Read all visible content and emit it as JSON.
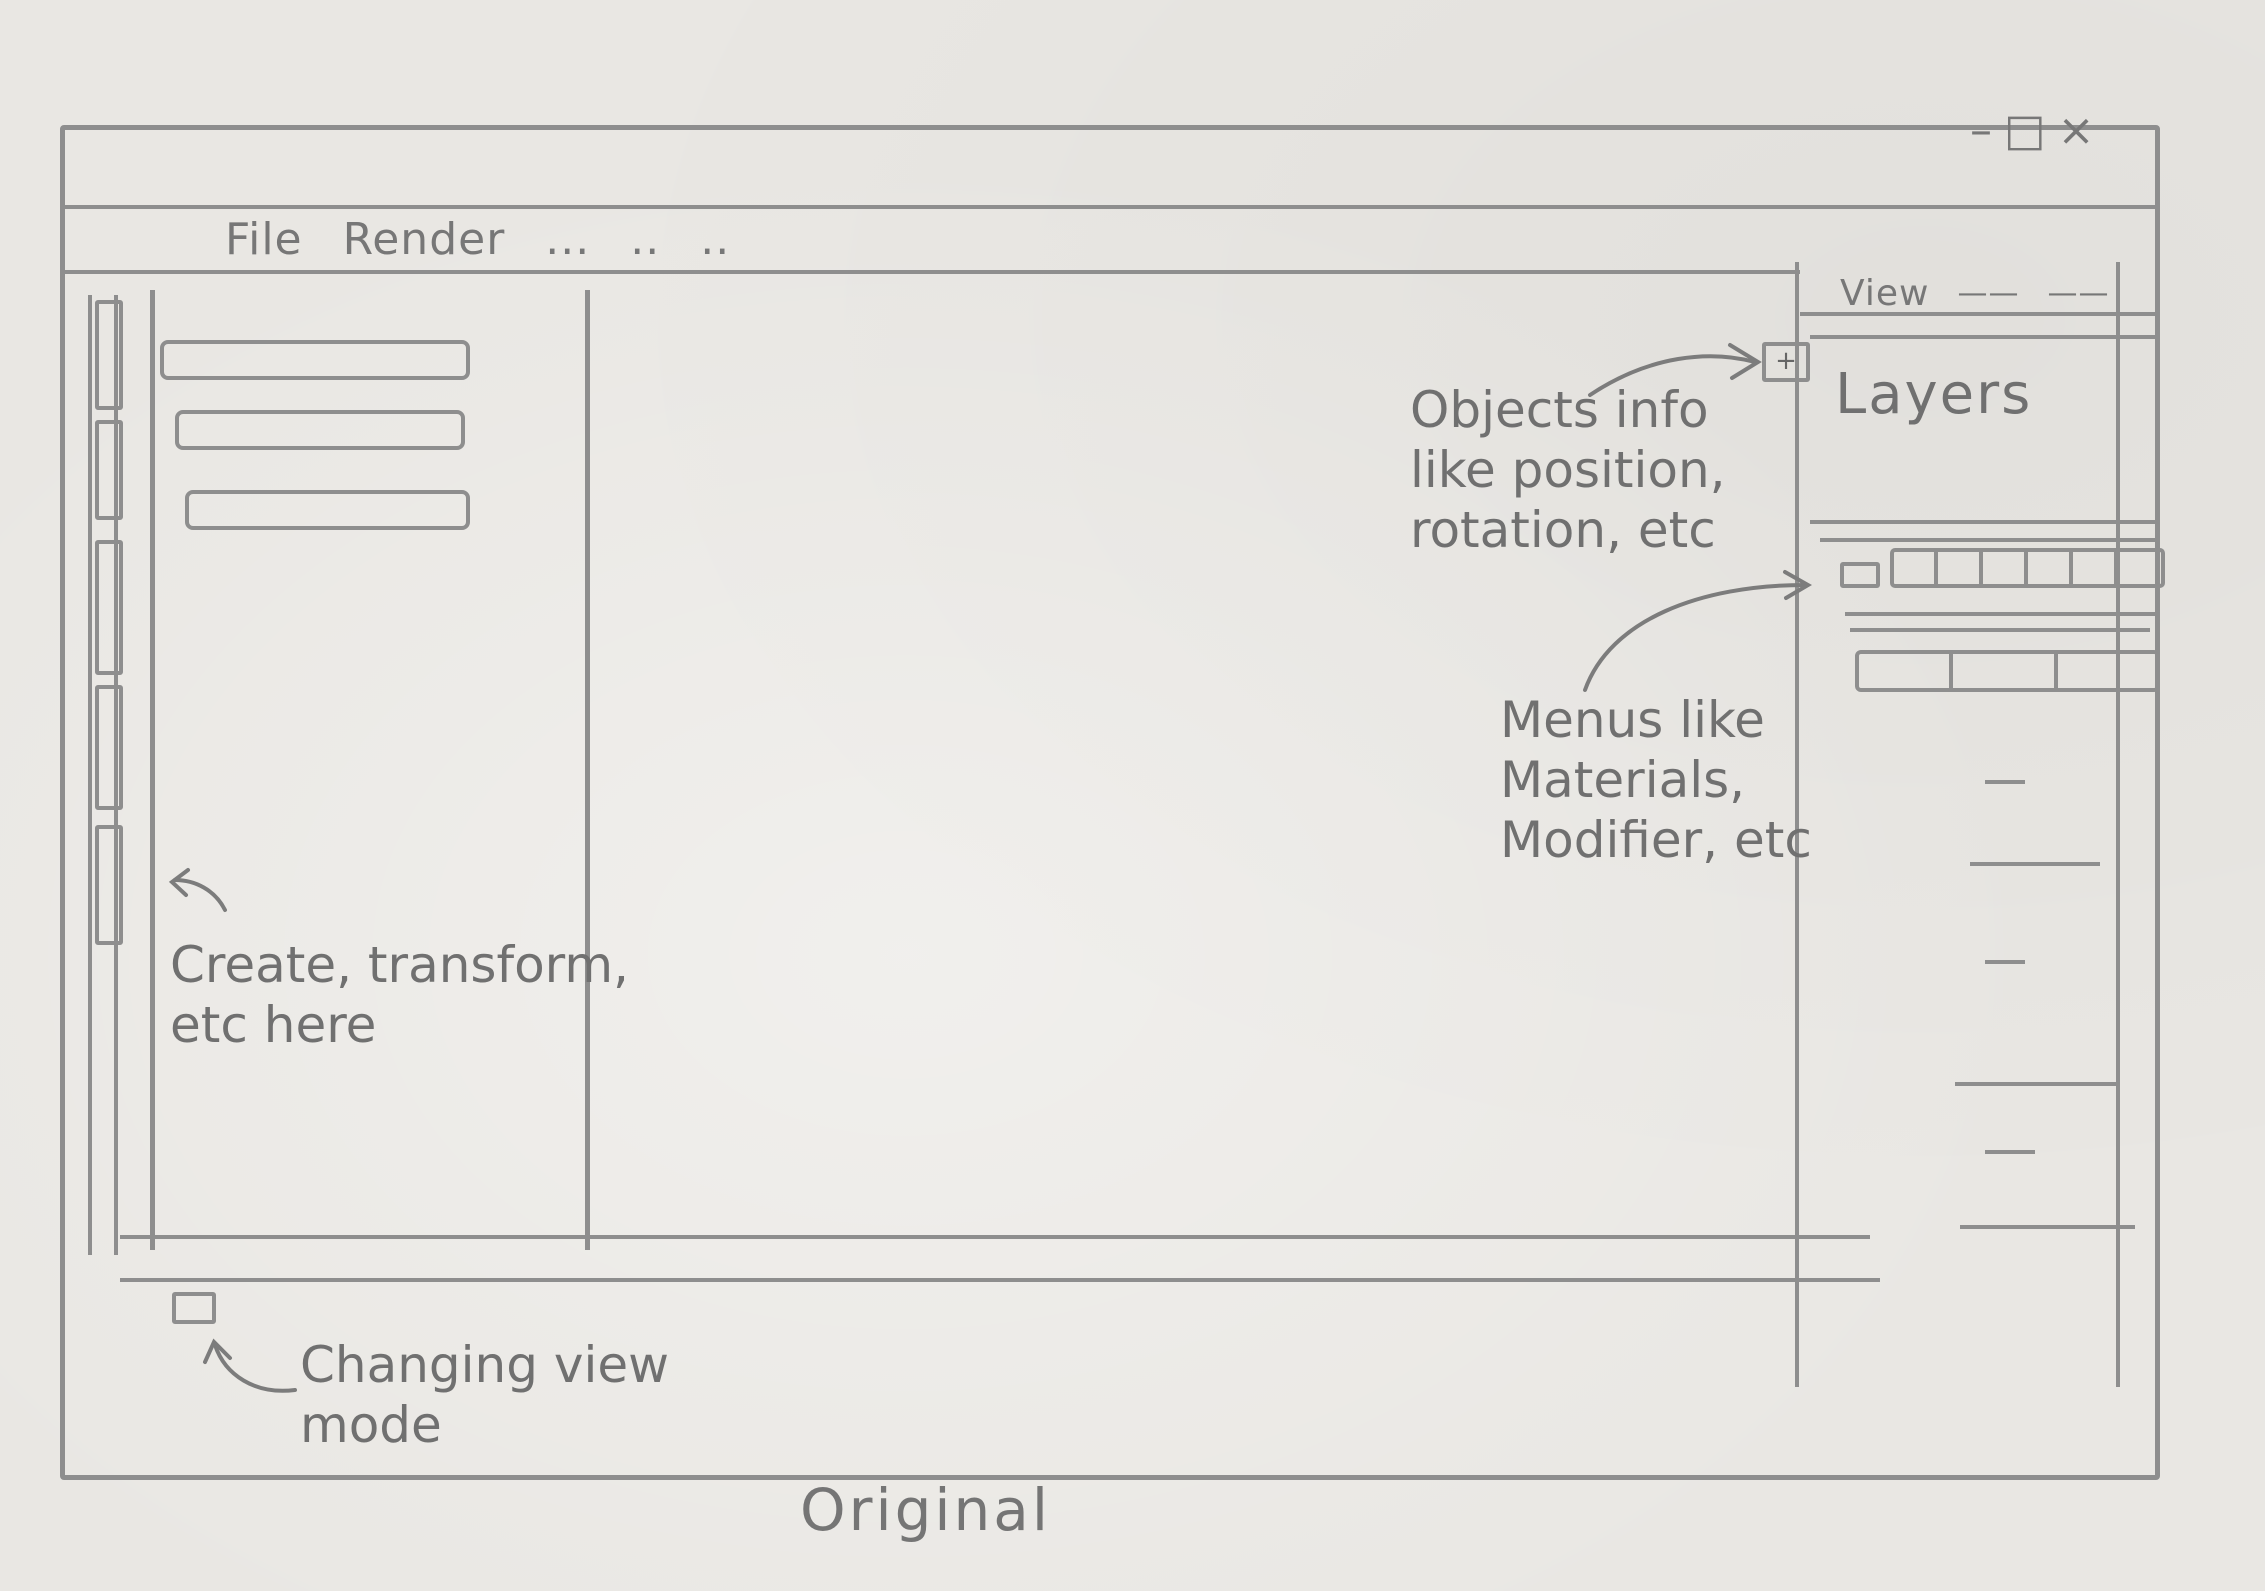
{
  "window": {
    "controls": [
      "–",
      "□",
      "×"
    ]
  },
  "menubar": {
    "items": [
      "File",
      "Render",
      "...",
      "..",
      ".."
    ]
  },
  "right_panel": {
    "header_items": [
      "View",
      "——",
      "——"
    ],
    "add_button": "+",
    "layers_label": "Layers"
  },
  "annotations": {
    "objects_info": [
      "Objects info",
      "like position,",
      "rotation, etc"
    ],
    "menus": [
      "Menus like",
      "Materials,",
      "Modifier, etc"
    ],
    "create_transform": [
      "Create, transform,",
      "etc here"
    ],
    "view_mode": "Changing view mode"
  },
  "caption": "Original"
}
